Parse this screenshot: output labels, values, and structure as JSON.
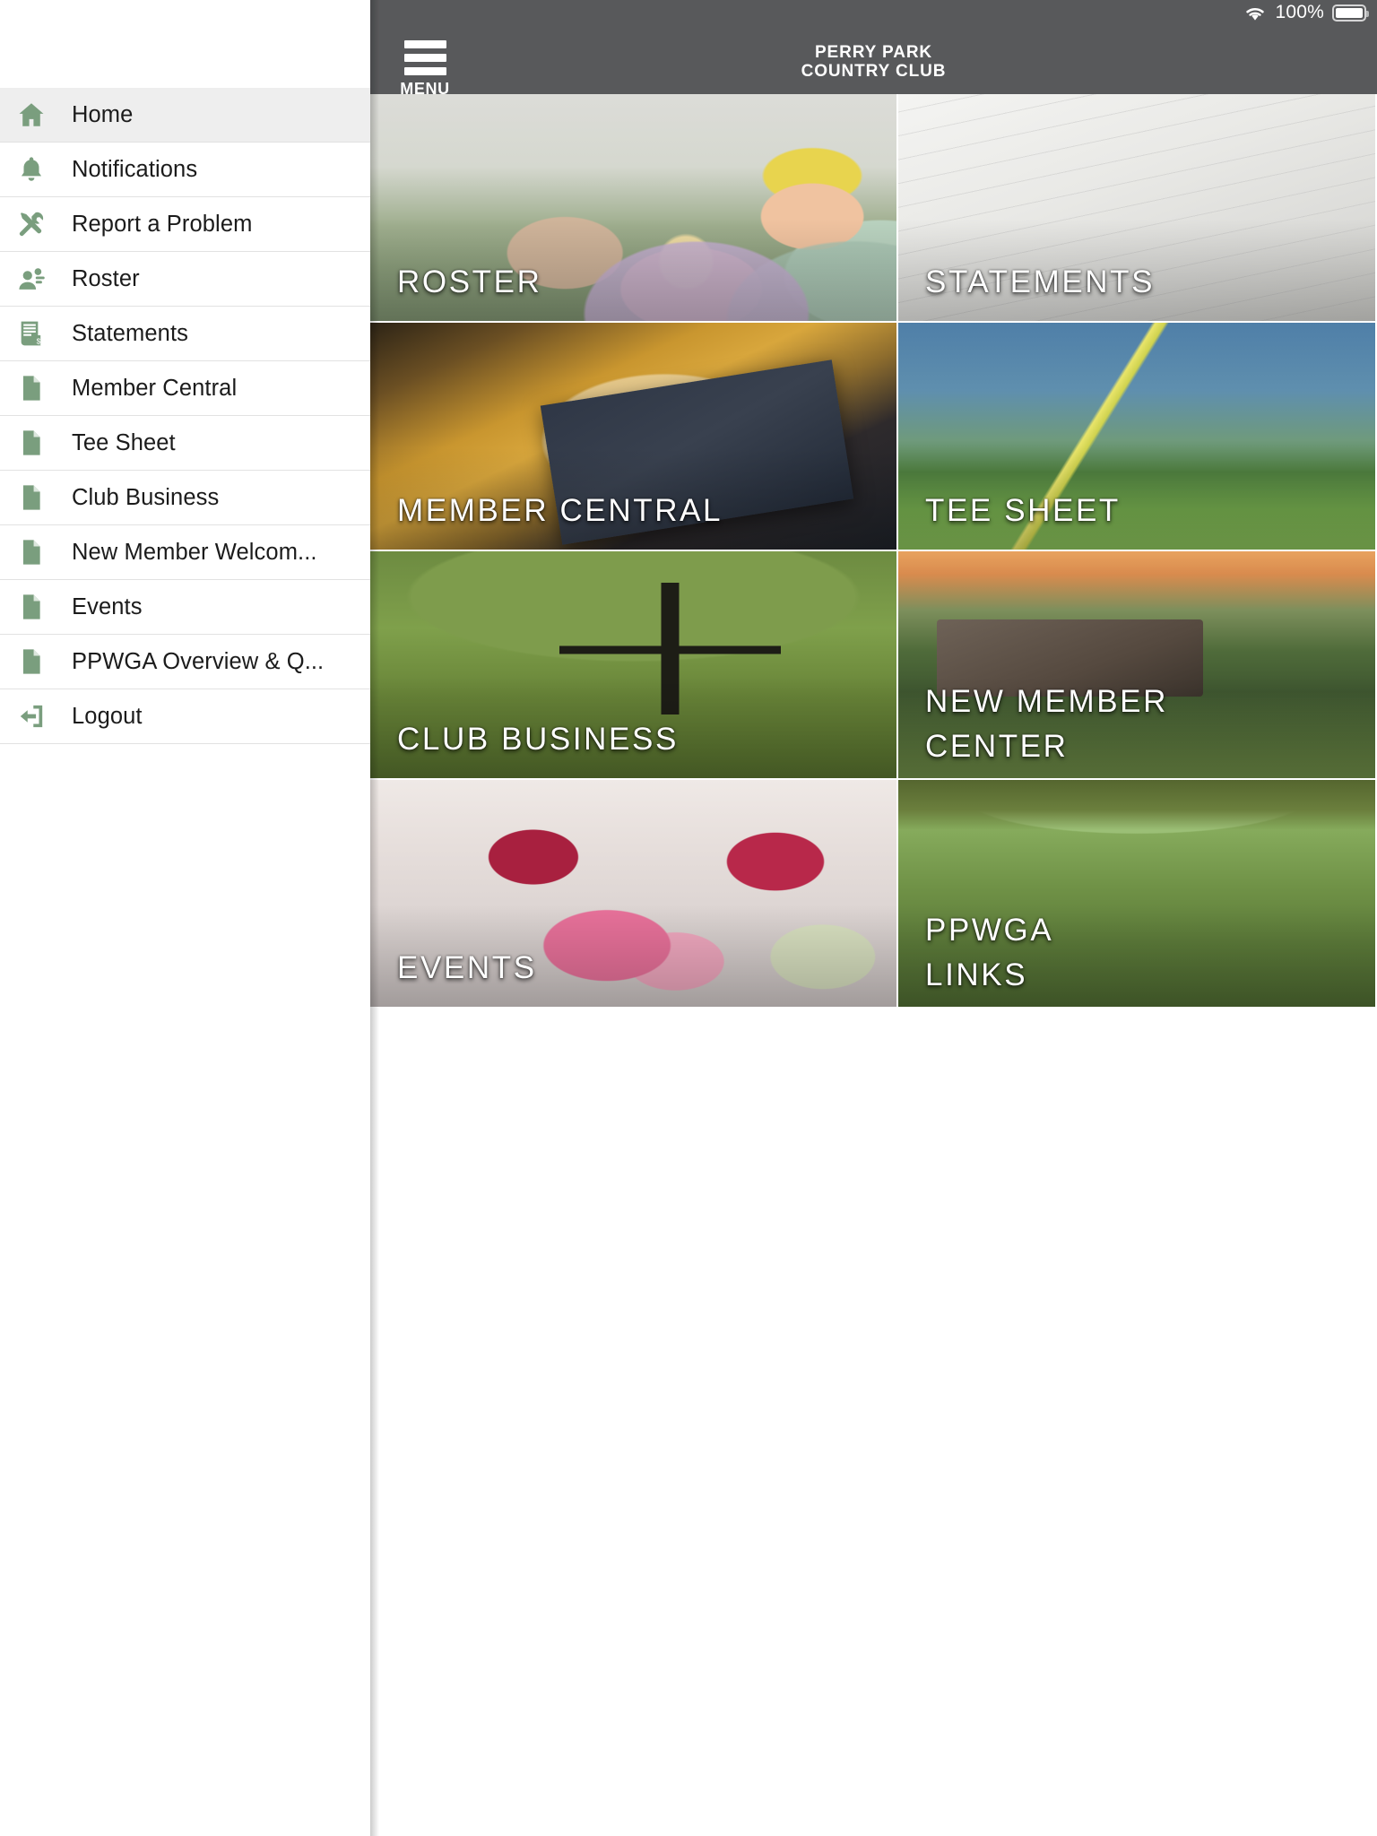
{
  "status_bar": {
    "wifi_icon": "wifi-icon",
    "battery_percent": "100%",
    "battery_icon": "battery-full-icon"
  },
  "app_bar": {
    "menu_icon": "hamburger-menu-icon",
    "menu_label": "MENU",
    "club_name_line1": "PERRY PARK",
    "club_name_line2": "COUNTRY CLUB",
    "background_color": "#58595b"
  },
  "sidebar": {
    "accent_color": "#7a9e7e",
    "active_background": "#eeeeee",
    "items": [
      {
        "label": "Home",
        "icon": "home-icon",
        "active": true
      },
      {
        "label": "Notifications",
        "icon": "bell-icon",
        "active": false
      },
      {
        "label": "Report a Problem",
        "icon": "tools-icon",
        "active": false
      },
      {
        "label": "Roster",
        "icon": "people-icon",
        "active": false
      },
      {
        "label": "Statements",
        "icon": "invoice-icon",
        "active": false
      },
      {
        "label": "Member Central",
        "icon": "document-icon",
        "active": false
      },
      {
        "label": "Tee Sheet",
        "icon": "document-icon",
        "active": false
      },
      {
        "label": "Club Business",
        "icon": "document-icon",
        "active": false
      },
      {
        "label": "New Member Welcom...",
        "icon": "document-icon",
        "active": false
      },
      {
        "label": "Events",
        "icon": "document-icon",
        "active": false
      },
      {
        "label": "PPWGA Overview & Q...",
        "icon": "document-icon",
        "active": false
      },
      {
        "label": "Logout",
        "icon": "logout-icon",
        "active": false
      }
    ]
  },
  "tiles": [
    {
      "label": "ROSTER",
      "art": "art-roster",
      "span": 1
    },
    {
      "label": "STATEMENTS",
      "art": "art-statements",
      "span": 1
    },
    {
      "label": "MEMBER CENTRAL",
      "art": "art-member",
      "span": 1
    },
    {
      "label": "TEE SHEET",
      "art": "art-teesheet",
      "span": 1
    },
    {
      "label": "CLUB BUSINESS",
      "art": "art-club",
      "span": 1
    },
    {
      "label": "NEW MEMBER\nCENTER",
      "art": "art-newmember",
      "span": 1
    },
    {
      "label": "EVENTS",
      "art": "art-events",
      "span": 1
    },
    {
      "label": "PPWGA\nLINKS",
      "art": "art-ppwga",
      "span": 1
    }
  ]
}
